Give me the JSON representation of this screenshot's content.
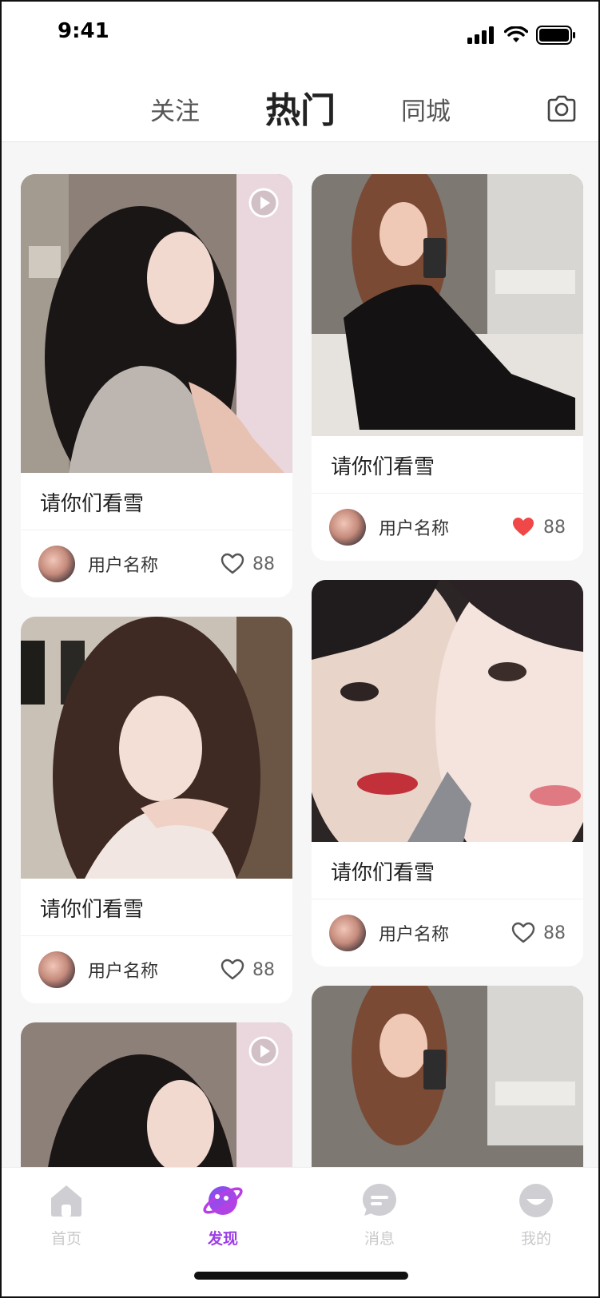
{
  "status": {
    "time": "9:41"
  },
  "top_nav": {
    "tabs": [
      {
        "label": "关注",
        "active": false
      },
      {
        "label": "热门",
        "active": true
      },
      {
        "label": "同城",
        "active": false
      }
    ]
  },
  "feed": {
    "cards": [
      {
        "title": "请你们看雪",
        "username": "用户名称",
        "likes": "88",
        "liked": false,
        "video": true
      },
      {
        "title": "请你们看雪",
        "username": "用户名称",
        "likes": "88",
        "liked": false,
        "video": false
      },
      {
        "title": "请你们看雪",
        "username": "用户名称",
        "likes": "88",
        "liked": true,
        "video": false
      },
      {
        "title": "请你们看雪",
        "username": "用户名称",
        "likes": "88",
        "liked": false,
        "video": false
      }
    ]
  },
  "tab_bar": {
    "items": [
      {
        "label": "首页",
        "active": false
      },
      {
        "label": "发现",
        "active": true
      },
      {
        "label": "消息",
        "active": false
      },
      {
        "label": "我的",
        "active": false
      }
    ]
  },
  "colors": {
    "accent": "#9b3ee6",
    "liked_heart": "#f04848",
    "inactive_tab": "#c9c9cc"
  }
}
